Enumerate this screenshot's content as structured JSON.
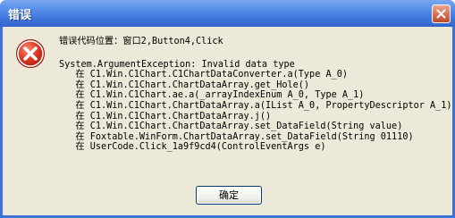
{
  "window": {
    "title": "错误",
    "close_icon": "close-icon"
  },
  "message": {
    "icon": "error-icon",
    "header": "错误代码位置：窗口2,Button4,Click",
    "exception": "System.ArgumentException: Invalid data type",
    "stack": [
      "   在 C1.Win.C1Chart.C1ChartDataConverter.a(Type A_0)",
      "   在 C1.Win.C1Chart.ChartDataArray.get_Hole()",
      "   在 C1.Win.C1Chart.ae.a(_arrayIndexEnum A_0, Type A_1)",
      "   在 C1.Win.C1Chart.ChartDataArray.a(IList A_0, PropertyDescriptor A_1)",
      "   在 C1.Win.C1Chart.ChartDataArray.j()",
      "   在 C1.Win.C1Chart.ChartDataArray.set_DataField(String value)",
      "   在 Foxtable.WinForm.ChartDataArray.set_DataField(String 01110)",
      "   在 UserCode.Click_1a9f9cd4(ControlEventArgs e)"
    ]
  },
  "buttons": {
    "ok_label": "确定"
  },
  "colors": {
    "titlebar": "#3f76dd",
    "client": "#ece9d8",
    "error_red": "#d42a1a"
  }
}
